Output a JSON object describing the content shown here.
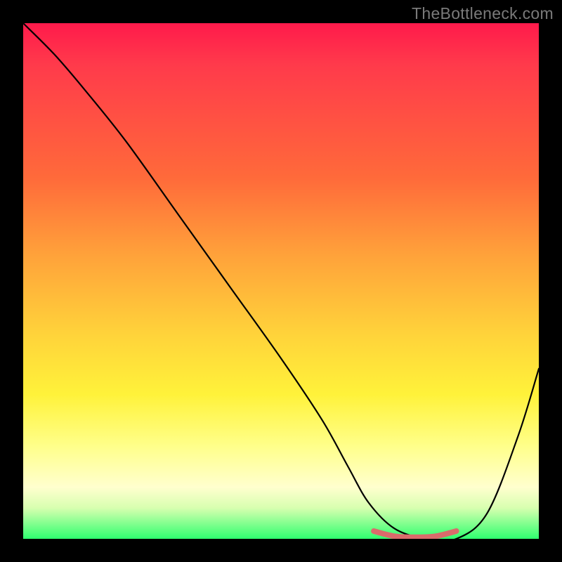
{
  "watermark": "TheBottleneck.com",
  "chart_data": {
    "type": "line",
    "title": "",
    "xlabel": "",
    "ylabel": "",
    "xlim": [
      0,
      100
    ],
    "ylim": [
      0,
      100
    ],
    "grid": false,
    "legend": false,
    "background_gradient": {
      "direction": "vertical",
      "stops": [
        {
          "pos": 0,
          "color": "#ff1a4b"
        },
        {
          "pos": 30,
          "color": "#ff6a3a"
        },
        {
          "pos": 60,
          "color": "#ffd23a"
        },
        {
          "pos": 82,
          "color": "#ffff8a"
        },
        {
          "pos": 94,
          "color": "#d8ffb0"
        },
        {
          "pos": 100,
          "color": "#2fff6f"
        }
      ]
    },
    "series": [
      {
        "name": "bottleneck-curve",
        "color": "#000000",
        "x": [
          0,
          6,
          12,
          20,
          30,
          40,
          50,
          58,
          63,
          67,
          72,
          78,
          84,
          90,
          96,
          100
        ],
        "y": [
          100,
          94,
          87,
          77,
          63,
          49,
          35,
          23,
          14,
          7,
          2,
          0,
          0,
          5,
          20,
          33
        ]
      },
      {
        "name": "optimal-band",
        "color": "#e06a6a",
        "x": [
          68,
          72,
          76,
          80,
          84
        ],
        "y": [
          1.5,
          0.5,
          0.3,
          0.5,
          1.5
        ]
      }
    ]
  }
}
